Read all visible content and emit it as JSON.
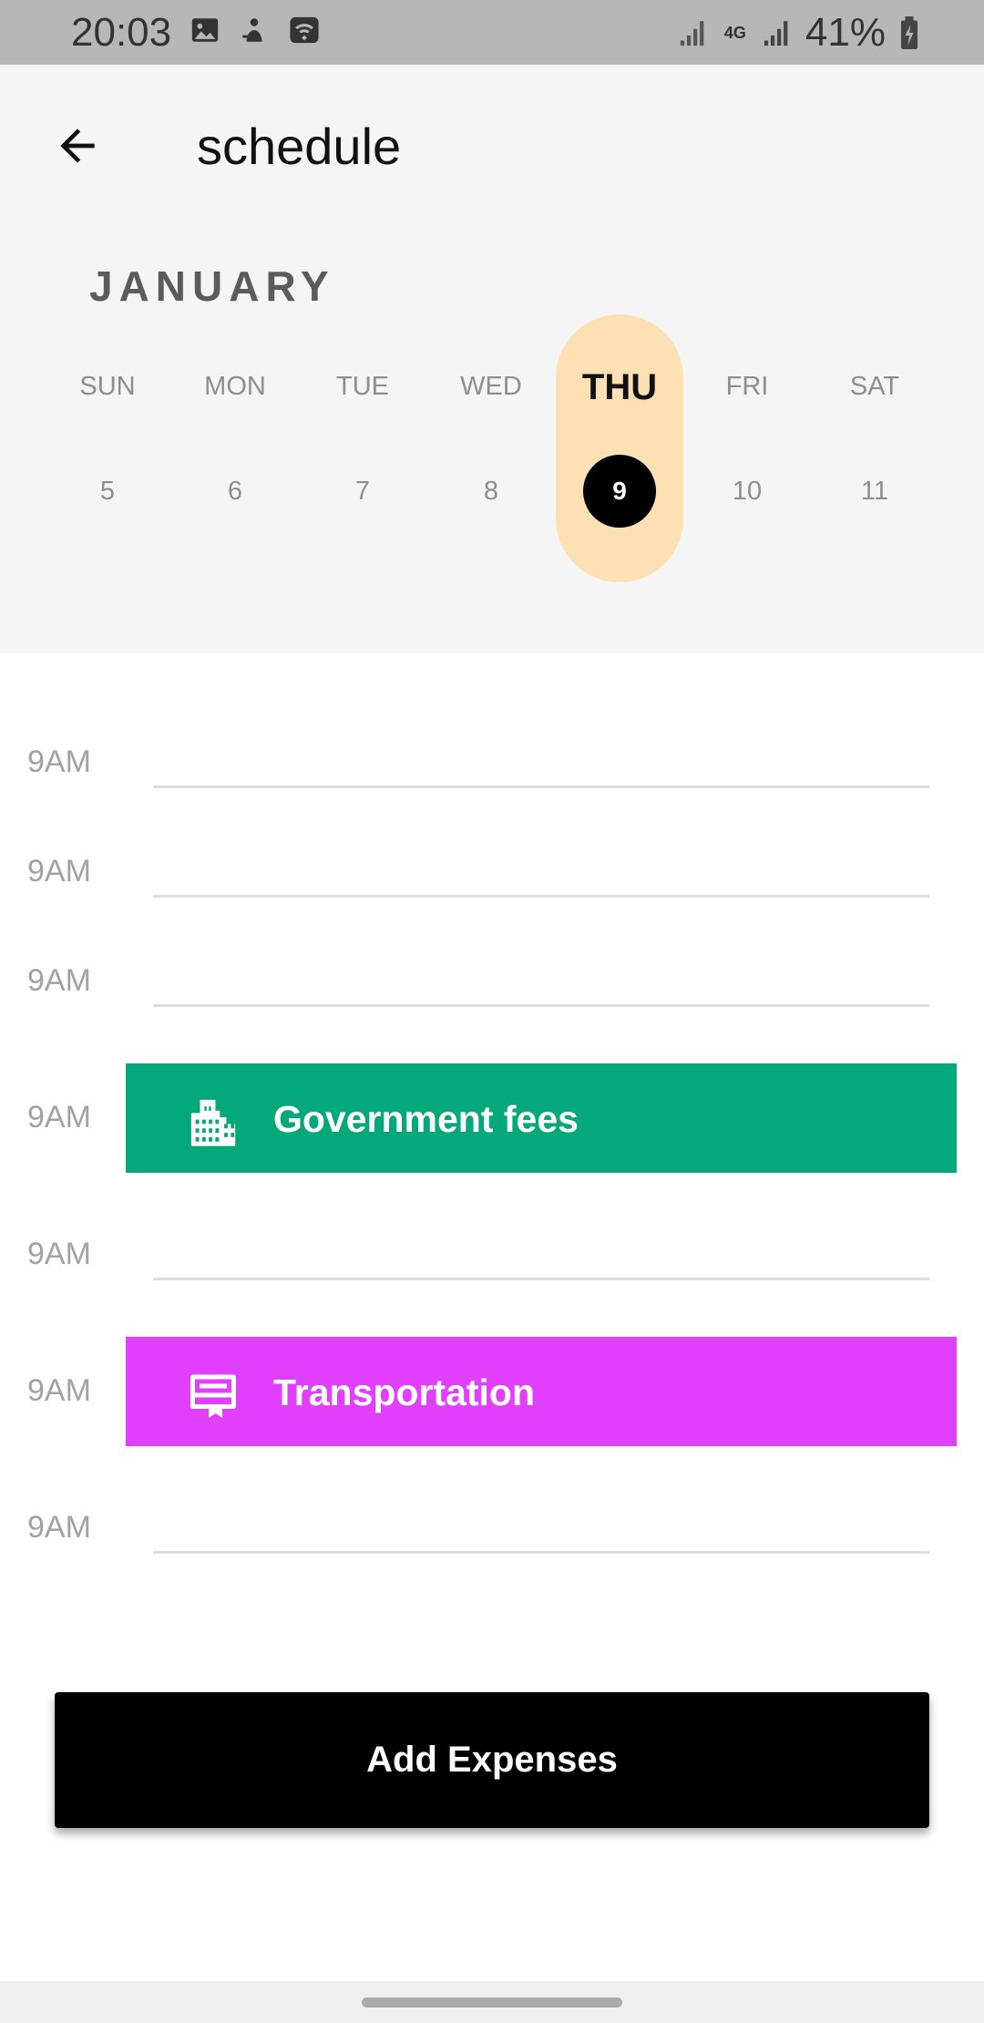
{
  "status_bar": {
    "time": "20:03",
    "network": "4G",
    "battery": "41%"
  },
  "header": {
    "title": "schedule",
    "month": "JANUARY"
  },
  "calendar": {
    "days": [
      {
        "name": "SUN",
        "num": "5"
      },
      {
        "name": "MON",
        "num": "6"
      },
      {
        "name": "TUE",
        "num": "7"
      },
      {
        "name": "WED",
        "num": "8"
      },
      {
        "name": "THU",
        "num": "9"
      },
      {
        "name": "FRI",
        "num": "10"
      },
      {
        "name": "SAT",
        "num": "11"
      }
    ],
    "selected_index": 4
  },
  "schedule": {
    "slots": [
      {
        "time": "9AM"
      },
      {
        "time": "9AM"
      },
      {
        "time": "9AM"
      },
      {
        "time": "9AM",
        "event": "Government fees",
        "icon": "building-icon",
        "color": "#05a87a"
      },
      {
        "time": "9AM"
      },
      {
        "time": "9AM",
        "event": "Transportation",
        "icon": "card-icon",
        "color": "#e040fb"
      },
      {
        "time": "9AM"
      }
    ]
  },
  "actions": {
    "add_label": "Add Expenses"
  },
  "colors": {
    "accent": "#fde0b3",
    "government": "#05a87a",
    "transportation": "#e040fb"
  }
}
